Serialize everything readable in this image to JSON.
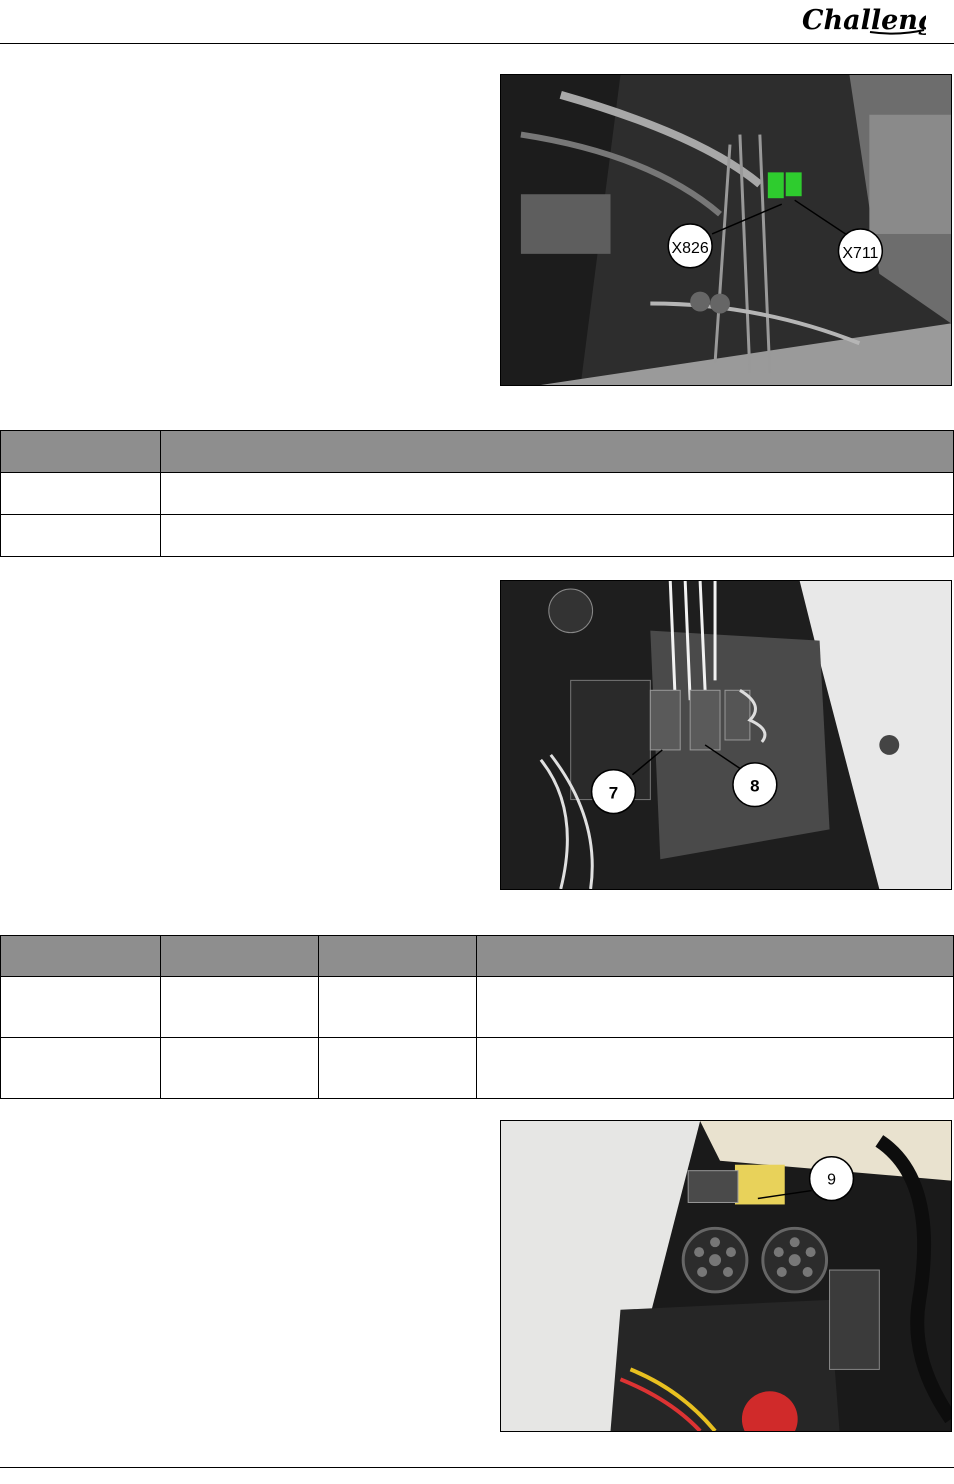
{
  "header": {
    "logo_text": "Challenger"
  },
  "photo_1": {
    "callouts": [
      "X826",
      "X711"
    ]
  },
  "table_1": {
    "headers": [
      "",
      ""
    ],
    "rows": [
      [
        "",
        ""
      ],
      [
        "",
        ""
      ]
    ]
  },
  "photo_2": {
    "callouts": [
      "7",
      "8"
    ]
  },
  "table_2": {
    "headers": [
      "",
      "",
      "",
      ""
    ],
    "rows": [
      [
        "",
        "",
        "",
        ""
      ],
      [
        "",
        "",
        "",
        ""
      ]
    ]
  },
  "photo_3": {
    "callouts": [
      "9"
    ]
  },
  "colors": {
    "header_fill": "#8e8e8e",
    "connector_green": "#2ecc2e"
  }
}
